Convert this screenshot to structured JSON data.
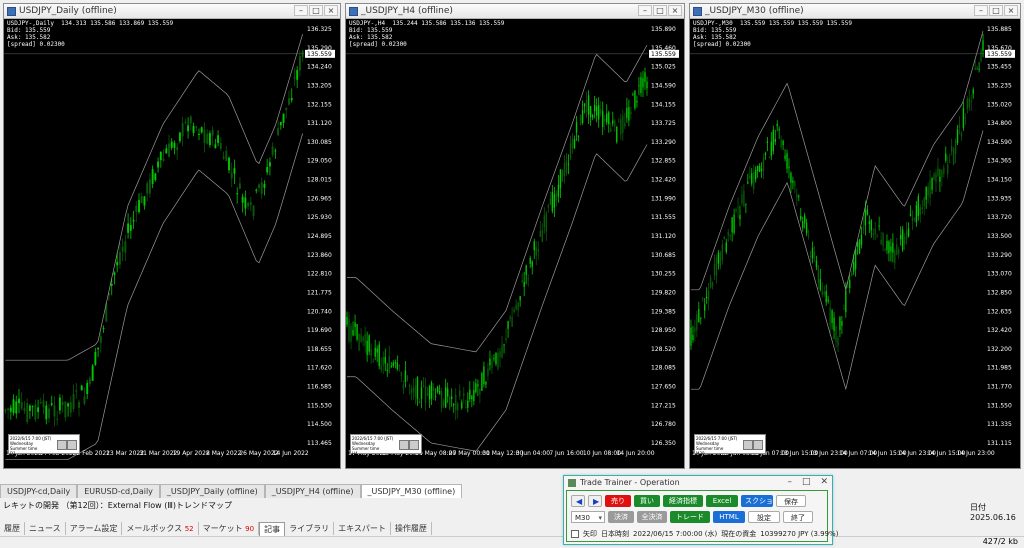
{
  "windows": [
    {
      "id": "w1",
      "title": "USDJPY_Daily (offline)",
      "info": [
        "USDJPY-,Daily",
        "Bid: 135.559",
        "Ask: 135.582",
        "[spread] 0.02300"
      ],
      "ohlc": "134.313 135.586 133.869 135.559",
      "price_tag": "135.559",
      "yticks": [
        "136.325",
        "135.290",
        "134.240",
        "133.205",
        "132.155",
        "131.120",
        "130.085",
        "129.050",
        "128.015",
        "126.965",
        "125.930",
        "124.895",
        "123.860",
        "122.810",
        "121.775",
        "120.740",
        "119.690",
        "118.655",
        "117.620",
        "116.585",
        "115.530",
        "114.500",
        "113.465"
      ],
      "xticks": [
        "19 Jan 2022",
        "14 Feb 2022",
        "22 Feb 2022",
        "13 Mar 2022",
        "31 Mar 2022",
        "19 Apr 2022",
        "8 May 2022",
        "26 May 2022",
        "14 Jun 2022"
      ],
      "mini": [
        "2022/6/15 7:00 (JST)",
        "Wednesday",
        "Summer time",
        "D1"
      ]
    },
    {
      "id": "w2",
      "title": "_USDJPY_H4 (offline)",
      "info": [
        "USDJPY-,H4",
        "Bid: 135.559",
        "Ask: 135.582",
        "[spread] 0.02300"
      ],
      "ohlc": "135.244 135.586 135.136 135.559",
      "price_tag": "135.559",
      "yticks": [
        "135.890",
        "135.460",
        "135.025",
        "134.590",
        "134.155",
        "133.725",
        "133.290",
        "132.855",
        "132.420",
        "131.990",
        "131.555",
        "131.120",
        "130.685",
        "130.255",
        "129.820",
        "129.385",
        "128.950",
        "128.520",
        "128.085",
        "127.650",
        "127.215",
        "126.780",
        "126.350"
      ],
      "xticks": [
        "17 May 2022",
        "19 May 20:00",
        "24 May 08:00",
        "27 May 00:00",
        "31 May 12:00",
        "3 Jun 04:00",
        "7 Jun 16:00",
        "10 Jun 08:00",
        "14 Jun 20:00"
      ],
      "mini": [
        "2022/6/15 7:00 (JST)",
        "Wednesday",
        "Summer time",
        "H4"
      ]
    },
    {
      "id": "w3",
      "title": "_USDJPY_M30 (offline)",
      "info": [
        "USDJPY-,M30",
        "Bid: 135.559",
        "Ask: 135.582",
        "[spread] 0.02300"
      ],
      "ohlc": "135.559 135.559 135.559 135.559",
      "price_tag": "135.559",
      "yticks": [
        "135.885",
        "135.670",
        "135.455",
        "135.235",
        "135.020",
        "134.800",
        "134.590",
        "134.365",
        "134.150",
        "133.935",
        "133.720",
        "133.500",
        "133.290",
        "133.070",
        "132.850",
        "132.635",
        "132.420",
        "132.200",
        "131.985",
        "131.770",
        "131.550",
        "131.335",
        "131.115"
      ],
      "xticks": [
        "10 Jun 2022",
        "13 Jun 03:00",
        "13 Jun 07:00",
        "13 Jun 15:00",
        "13 Jun 23:00",
        "14 Jun 07:00",
        "14 Jun 15:00",
        "14 Jun 23:00",
        "14 Jun 15:00",
        "14 Jun 23:00"
      ],
      "mini": [
        "2022/6/15 7:00 (JST)",
        "Wednesday",
        "Summer time",
        "M30"
      ]
    }
  ],
  "tabs": [
    "USDJPY-cd,Daily",
    "EURUSD-cd,Daily",
    "_USDJPY_Daily (offline)",
    "_USDJPY_H4 (offline)",
    "_USDJPY_M30 (offline)"
  ],
  "news_line": "レキットの開発 （第12回）：External Flow (Ⅲ)トレンドマップ",
  "bottom_tabs": [
    {
      "label": "履歴"
    },
    {
      "label": "ニュース"
    },
    {
      "label": "アラーム設定"
    },
    {
      "label": "メールボックス",
      "badge": "52"
    },
    {
      "label": "マーケット",
      "badge": "90"
    },
    {
      "label": "記事"
    },
    {
      "label": "ライブラリ"
    },
    {
      "label": "エキスパート"
    },
    {
      "label": "操作履歴"
    }
  ],
  "right_info": {
    "label": "日付",
    "date": "2025.06.16"
  },
  "status_right": "427/2 kb",
  "trade_trainer": {
    "title": "Trade Trainer - Operation",
    "row1": {
      "prev": "◀",
      "next": "▶",
      "sell": "売り",
      "buy": "買い",
      "eco": "経済指標",
      "excel": "Excel",
      "screenshot": "スクショ",
      "save": "保存"
    },
    "row2": {
      "tf": "M30",
      "close": "決済",
      "close_all": "全決済",
      "trade": "トレード",
      "html": "HTML",
      "settings": "設定",
      "exit": "終了"
    },
    "row3": {
      "arrow": "矢印",
      "jtime_label": "日本時刻",
      "jtime": "2022/06/15 7:00:00 (水)",
      "funds_label": "現在の資金",
      "funds": "10399270 JPY (3.99%)"
    }
  },
  "colors": {
    "bull": "#00c800",
    "bear": "#0a5a0a",
    "band": "#9a9a9a",
    "chart_bg": "#000000"
  }
}
